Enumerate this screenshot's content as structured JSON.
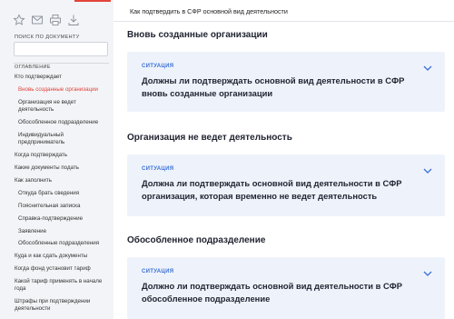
{
  "toolbar": {
    "icons": [
      "star-icon",
      "mail-icon",
      "print-icon",
      "download-icon"
    ]
  },
  "sidebar": {
    "search_label": "ПОИСК ПО ДОКУМЕНТУ",
    "search_placeholder": "",
    "toc_title": "ОГЛАВЛЕНИЕ",
    "items": [
      {
        "label": "Кто подтверждает",
        "level": "top",
        "active": false
      },
      {
        "label": "Вновь созданные организации",
        "level": "sub",
        "active": true
      },
      {
        "label": "Организация не ведет",
        "level": "sub",
        "active": false
      },
      {
        "label": "деятельность",
        "level": "sub",
        "active": false
      },
      {
        "label": "Обособленное подразделение",
        "level": "sub",
        "active": false
      },
      {
        "label": "Индивидуальный",
        "level": "sub",
        "active": false
      },
      {
        "label": "предприниматель",
        "level": "sub",
        "active": false
      },
      {
        "label": "Когда подтверждать",
        "level": "top",
        "active": false
      },
      {
        "label": "Какие документы подать",
        "level": "top",
        "active": false
      },
      {
        "label": "Как заполнить",
        "level": "top",
        "active": false
      },
      {
        "label": "Откуда брать сведения",
        "level": "sub",
        "active": false
      },
      {
        "label": "Пояснительная записка",
        "level": "sub",
        "active": false
      },
      {
        "label": "Справка-подтверждение",
        "level": "sub",
        "active": false
      },
      {
        "label": "Заявление",
        "level": "sub",
        "active": false
      },
      {
        "label": "Обособленные подразделения",
        "level": "sub",
        "active": false
      },
      {
        "label": "Куда и как сдать документы",
        "level": "top",
        "active": false
      },
      {
        "label": "Когда фонд установит тариф",
        "level": "top",
        "active": false
      },
      {
        "label": "Какой тариф применять в начале",
        "level": "top",
        "active": false
      },
      {
        "label": "года",
        "level": "top",
        "active": false
      },
      {
        "label": "Штрафы при подтверждении",
        "level": "top",
        "active": false
      },
      {
        "label": "деятельности",
        "level": "top",
        "active": false
      }
    ]
  },
  "header": {
    "breadcrumb": "Как подтвердить в СФР основной вид деятельности"
  },
  "sections": [
    {
      "title": "Вновь созданные организации",
      "tag": "СИТУАЦИЯ",
      "text_lines": [
        "Должны ли подтверждать основной вид деятельности в СФР",
        "вновь созданные организации"
      ]
    },
    {
      "title": "Организация не ведет деятельность",
      "tag": "СИТУАЦИЯ",
      "text_lines": [
        "Должна ли подтверждать основной вид деятельности в СФР",
        "организация, которая временно не ведет деятельность"
      ]
    },
    {
      "title": "Обособленное подразделение",
      "tag": "СИТУАЦИЯ",
      "text_lines": [
        "Должно ли подтверждать основной вид деятельности в СФР",
        "обособленное подразделение"
      ]
    }
  ],
  "colors": {
    "accent": "#e1443a",
    "link": "#3b6fd6",
    "card_bg": "#eef3fb",
    "sidebar_bg": "#f3f4f7"
  }
}
